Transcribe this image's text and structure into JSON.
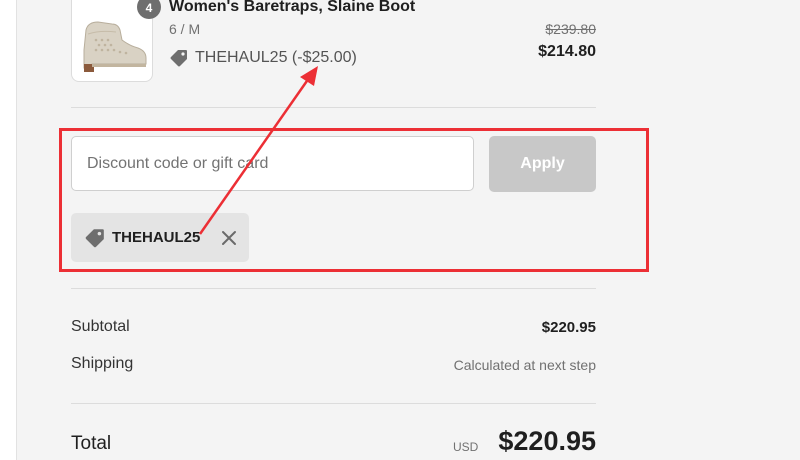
{
  "line_item": {
    "quantity": "4",
    "name": "Women's Baretraps, Slaine Boot",
    "variant": "6 / M",
    "discount_label": "THEHAUL25 (-$25.00)",
    "original_price": "$239.80",
    "price": "$214.80",
    "thumbnail_icon": "ankle-boot-image"
  },
  "discount": {
    "placeholder": "Discount code or gift card",
    "apply_label": "Apply",
    "applied_code": "THEHAUL25",
    "tag_icon": "tag-icon",
    "remove_icon": "close-icon"
  },
  "summary": {
    "subtotal_label": "Subtotal",
    "subtotal_value": "$220.95",
    "shipping_label": "Shipping",
    "shipping_value": "Calculated at next step",
    "total_label": "Total",
    "currency": "USD",
    "total_value": "$220.95"
  },
  "annotation": {
    "color": "#ec2f35"
  },
  "colors": {
    "panel_background": "#f4f4f4",
    "apply_disabled": "#c8c8c8",
    "tag_background": "#e4e4e4"
  }
}
